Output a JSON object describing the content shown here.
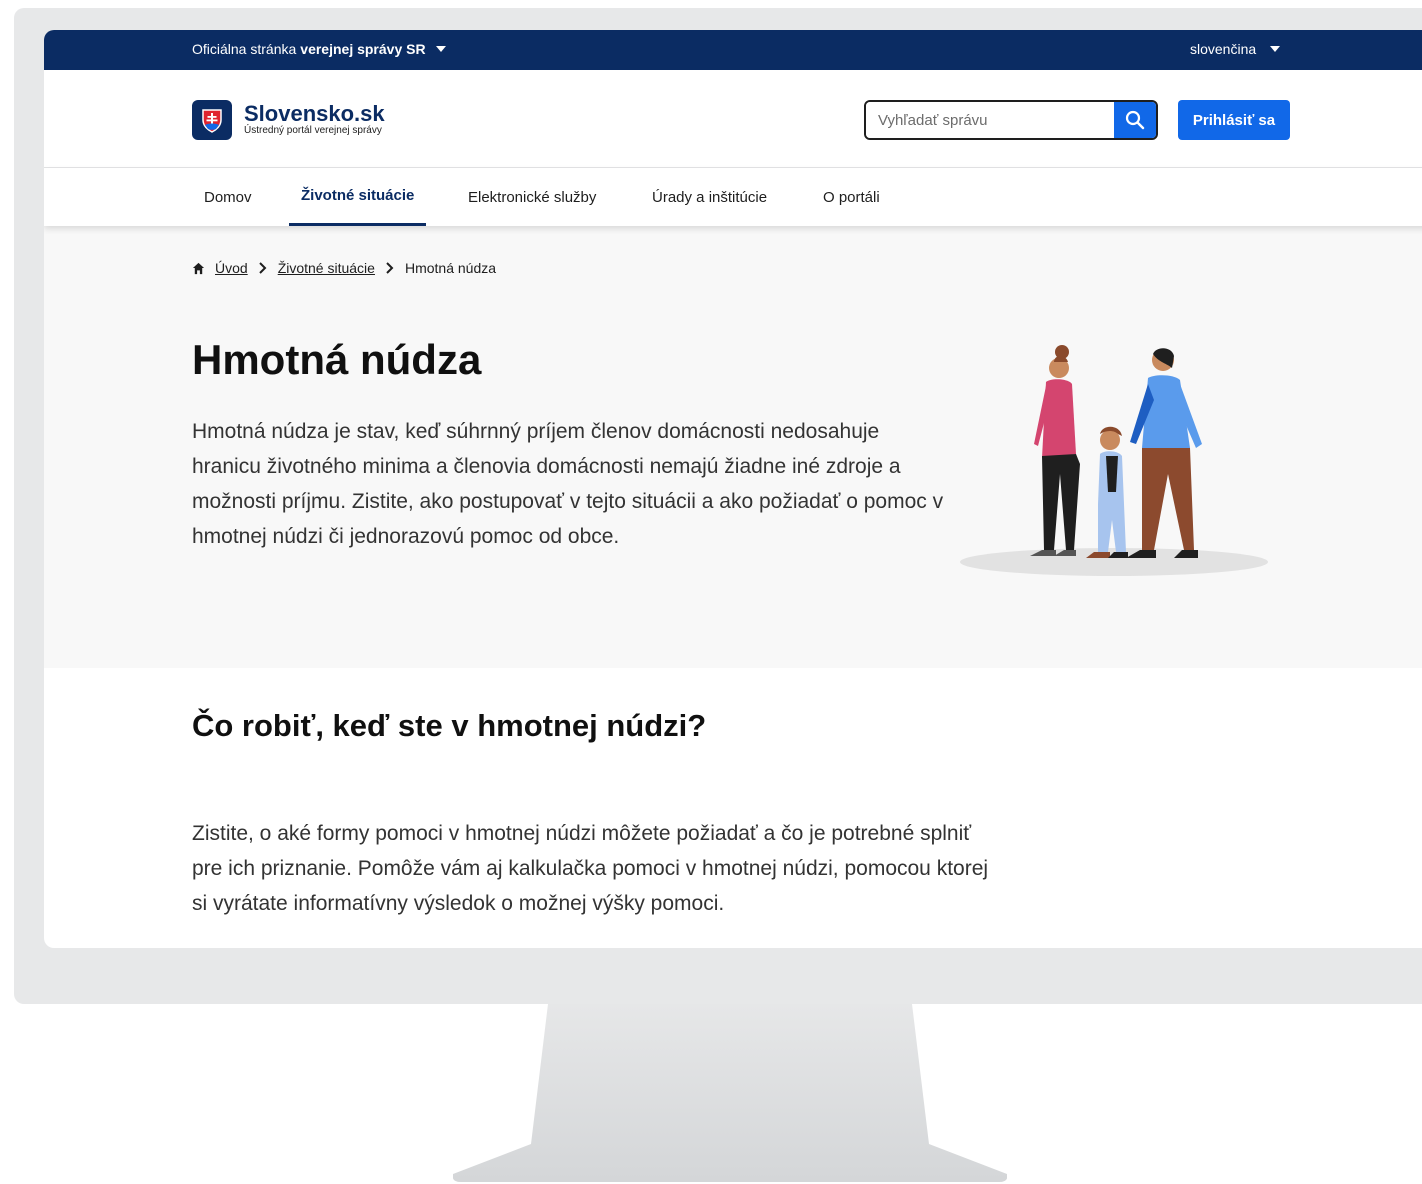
{
  "gov_bar": {
    "official_prefix": "Oficiálna stránka",
    "official_bold": "verejnej správy SR",
    "language": "slovenčina"
  },
  "header": {
    "logo_name": "Slovensko.sk",
    "logo_subtitle": "Ústredný portál verejnej správy",
    "search_placeholder": "Vyhľadať správu",
    "login_label": "Prihlásiť sa"
  },
  "nav": {
    "items": [
      {
        "label": "Domov"
      },
      {
        "label": "Životné situácie",
        "active": true
      },
      {
        "label": "Elektronické služby"
      },
      {
        "label": "Úrady a inštitúcie"
      },
      {
        "label": "O portáli"
      }
    ]
  },
  "breadcrumb": {
    "items": [
      "Úvod",
      "Životné situácie",
      "Hmotná núdza"
    ]
  },
  "hero": {
    "title": "Hmotná núdza",
    "text": "Hmotná núdza je stav, keď súhrnný príjem členov domácnosti nedosahuje hranicu životného minima a členovia domácnosti nemajú žiadne iné zdroje a možnosti príjmu. Zistite, ako postupovať v tejto situácii a ako požiadať o pomoc v hmotnej núdzi či jednorazovú pomoc od obce."
  },
  "section": {
    "title": "Čo robiť, keď ste v hmotnej núdzi?",
    "text": "Zistite, o aké formy pomoci v hmotnej núdzi môžete požiadať a čo je potrebné splniť pre ich priznanie. Pomôže vám aj kalkulačka pomoci v hmotnej núdzi, pomocou ktorej si vyrátate informatívny výsledok o možnej výšky pomoci."
  },
  "colors": {
    "brand_dark": "#0b2c63",
    "accent_blue": "#1168e8",
    "hero_bg": "#f8f8f8"
  }
}
